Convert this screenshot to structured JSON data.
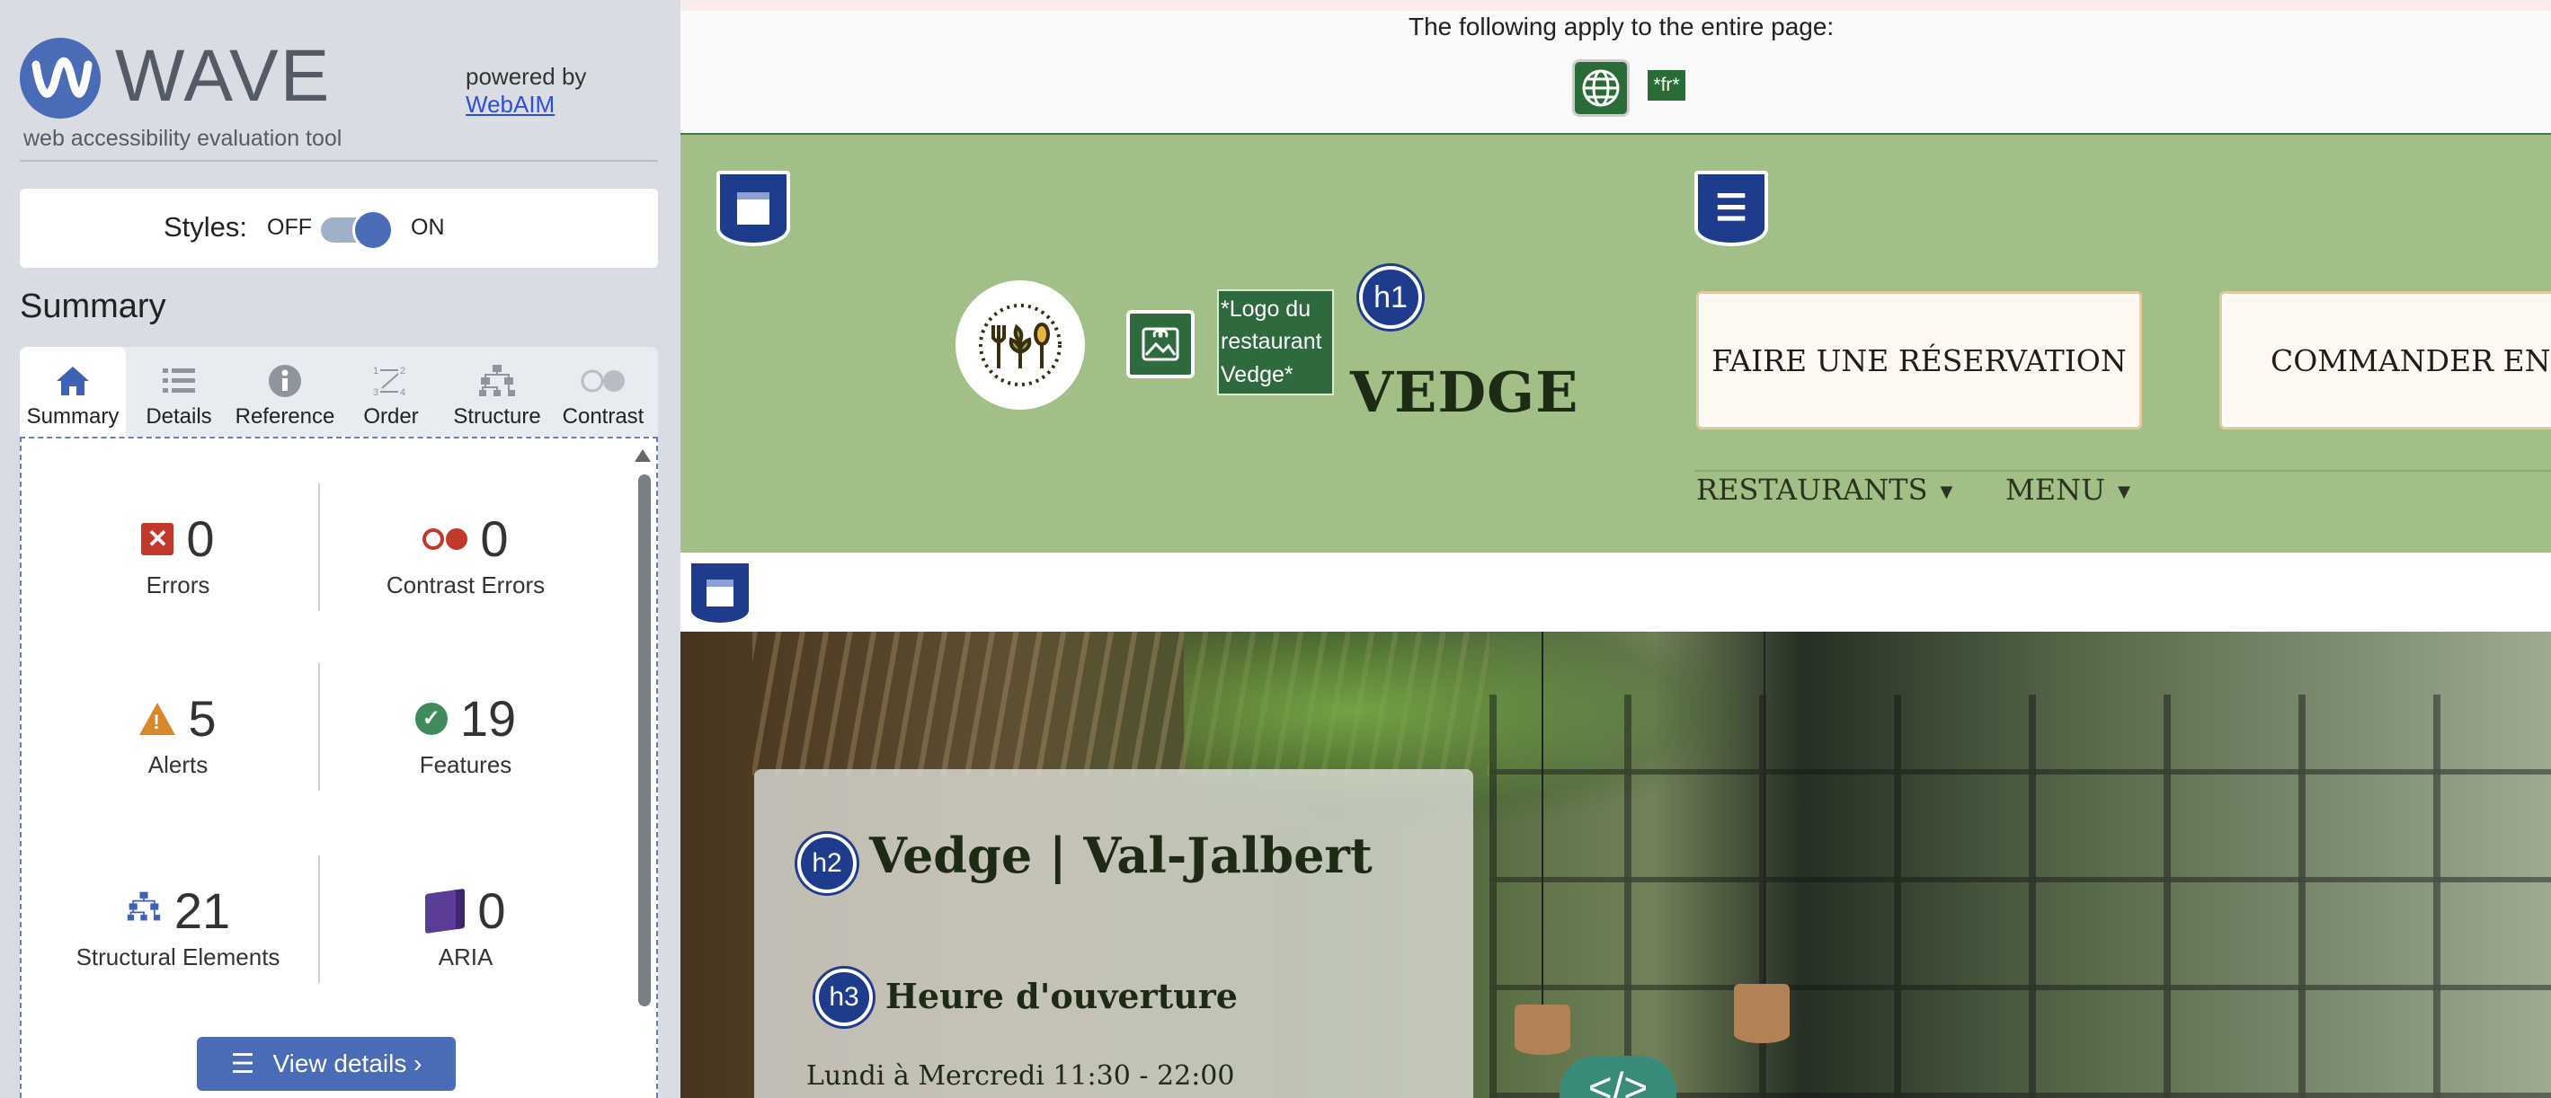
{
  "sidebar": {
    "app_name": "WAVE",
    "subtitle": "web accessibility evaluation tool",
    "powered_by": "powered by",
    "powered_link": "WebAIM",
    "styles_label": "Styles:",
    "styles_off": "OFF",
    "styles_on": "ON",
    "styles_state": "on",
    "summary_heading": "Summary",
    "tabs": [
      {
        "label": "Summary",
        "icon": "home-icon",
        "active": true
      },
      {
        "label": "Details",
        "icon": "list-icon",
        "active": false
      },
      {
        "label": "Reference",
        "icon": "info-icon",
        "active": false
      },
      {
        "label": "Order",
        "icon": "order-icon",
        "active": false
      },
      {
        "label": "Structure",
        "icon": "structure-icon",
        "active": false
      },
      {
        "label": "Contrast",
        "icon": "contrast-icon",
        "active": false
      }
    ],
    "stats": {
      "errors": {
        "count": "0",
        "label": "Errors"
      },
      "contrast_errors": {
        "count": "0",
        "label": "Contrast Errors"
      },
      "alerts": {
        "count": "5",
        "label": "Alerts"
      },
      "features": {
        "count": "19",
        "label": "Features"
      },
      "structural": {
        "count": "21",
        "label": "Structural Elements"
      },
      "aria": {
        "count": "0",
        "label": "ARIA"
      }
    },
    "view_details": "View details ›"
  },
  "page": {
    "apply_text": "The following apply to the entire page:",
    "lang_badge": "*fr*",
    "logo_alt": "*Logo du restaurant Vedge*",
    "h1_badge": "h1",
    "site_title": "VEDGE",
    "cta_reservation": "FAIRE UNE RÉSERVATION",
    "cta_order": "COMMANDER EN LIGNE",
    "nav": [
      {
        "label": "RESTAURANTS"
      },
      {
        "label": "MENU"
      }
    ],
    "h2_badge": "h2",
    "h2_text": "Vedge | Val-Jalbert",
    "h3_badge": "h3",
    "h3_text": "Heure d'ouverture",
    "hours": "Lundi à Mercredi 11:30 - 22:00",
    "code_badge": "</>"
  },
  "colors": {
    "wave_blue": "#4a6bb5",
    "header_green": "#a2bf87",
    "error_red": "#c0392b",
    "alert_orange": "#d6882b",
    "feature_green": "#3f8b5b",
    "aria_purple": "#5b3c96",
    "region_navy": "#1f3b8c"
  }
}
